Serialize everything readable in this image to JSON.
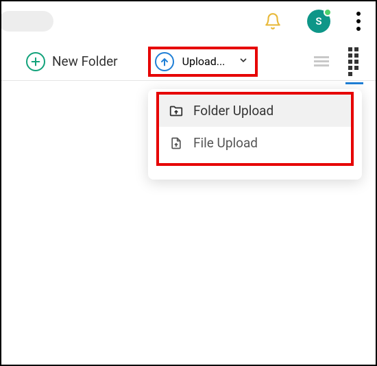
{
  "topbar": {
    "avatar_letter": "S"
  },
  "toolbar": {
    "new_folder_label": "New Folder",
    "upload_label": "Upload..."
  },
  "upload_menu": {
    "items": [
      {
        "label": "Folder Upload"
      },
      {
        "label": "File Upload"
      }
    ]
  }
}
